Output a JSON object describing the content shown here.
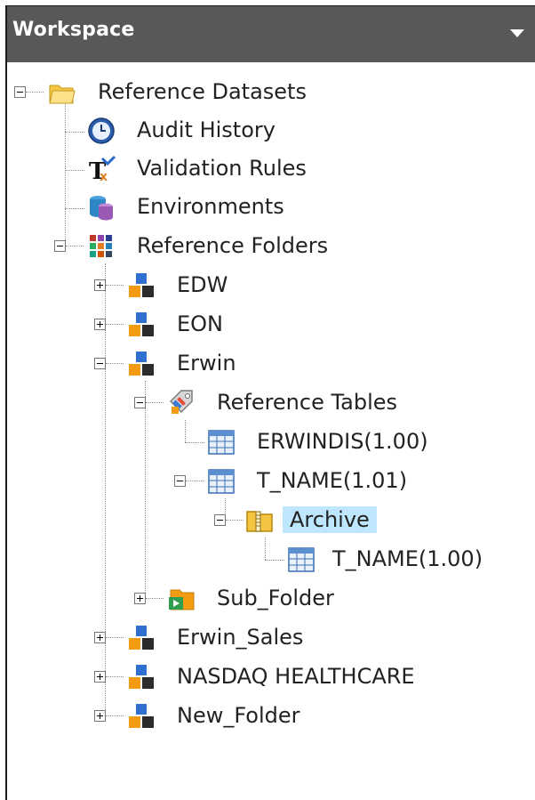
{
  "header": {
    "title": "Workspace",
    "menu_icon": "chevron-down-icon"
  },
  "tree": {
    "root": {
      "label": "Reference Datasets",
      "icon": "folder-open-icon"
    },
    "audit": {
      "label": "Audit History",
      "icon": "clock-icon"
    },
    "validation": {
      "label": "Validation Rules",
      "icon": "validation-rules-icon"
    },
    "environments": {
      "label": "Environments",
      "icon": "database-icon"
    },
    "ref_folders": {
      "label": "Reference Folders",
      "icon": "grid-icon"
    },
    "edw": {
      "label": "EDW",
      "icon": "folder-blocks-icon"
    },
    "eon": {
      "label": "EON",
      "icon": "folder-blocks-icon"
    },
    "erwin": {
      "label": "Erwin",
      "icon": "folder-blocks-icon"
    },
    "ref_tables": {
      "label": "Reference Tables",
      "icon": "tag-icon"
    },
    "erwindis": {
      "label": "ERWINDIS(1.00)",
      "icon": "table-icon"
    },
    "tname101": {
      "label": "T_NAME(1.01)",
      "icon": "table-icon"
    },
    "archive": {
      "label": "Archive",
      "icon": "archive-folder-icon"
    },
    "tname100": {
      "label": "T_NAME(1.00)",
      "icon": "table-icon"
    },
    "subfolder": {
      "label": "Sub_Folder",
      "icon": "sub-folder-icon"
    },
    "erwin_sales": {
      "label": "Erwin_Sales",
      "icon": "folder-blocks-icon"
    },
    "nasdaq": {
      "label": "NASDAQ HEALTHCARE",
      "icon": "folder-blocks-icon"
    },
    "new_folder": {
      "label": "New_Folder",
      "icon": "folder-blocks-icon"
    }
  },
  "colors": {
    "header_bg": "#585858",
    "selection_bg": "#bfe6ff"
  }
}
